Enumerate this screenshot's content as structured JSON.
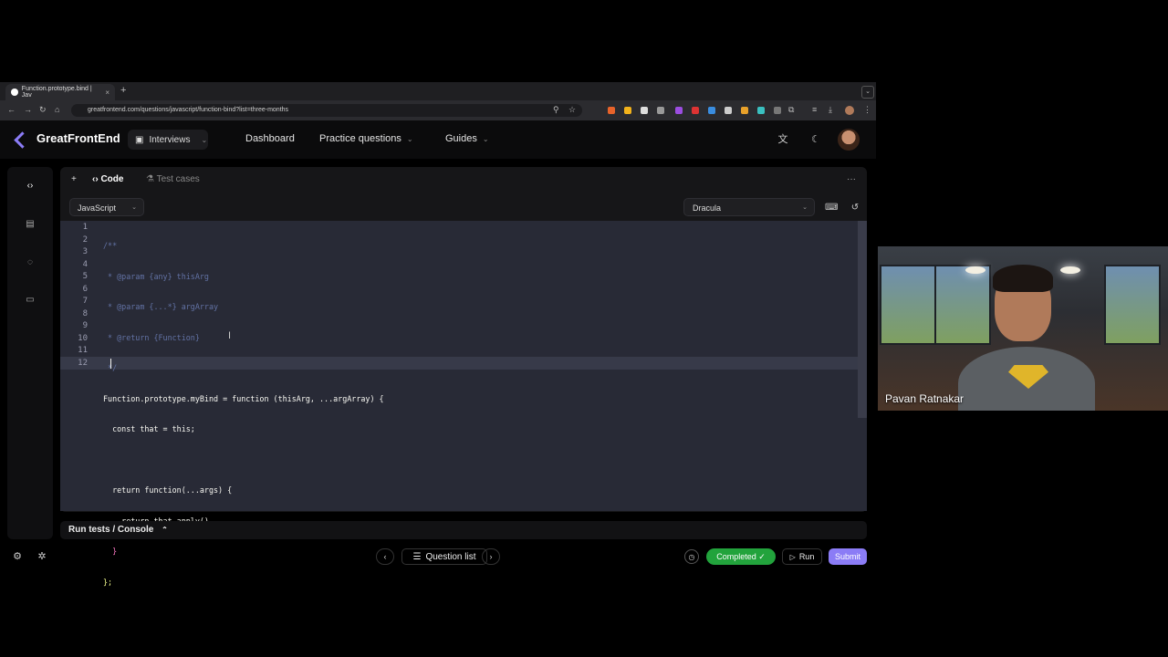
{
  "browser": {
    "tab_title": "Function.prototype.bind | Jav",
    "tab_close": "×",
    "new_tab": "+",
    "url": "greatfrontend.com/questions/javascript/function-bind?list=three-months"
  },
  "header": {
    "brand": "GreatFrontEnd",
    "interviews_label": "Interviews",
    "nav": [
      {
        "label": "Dashboard"
      },
      {
        "label": "Practice questions"
      },
      {
        "label": "Guides"
      }
    ]
  },
  "panel": {
    "add": "+",
    "code_tab": "Code",
    "test_tab": "Test cases",
    "more": "···",
    "language": "JavaScript",
    "theme": "Dracula"
  },
  "editor": {
    "line_numbers": [
      "1",
      "2",
      "3",
      "4",
      "5",
      "6",
      "7",
      "8",
      "9",
      "10",
      "11",
      "12"
    ],
    "lines": [
      "/**",
      " * @param {any} thisArg",
      " * @param {...*} argArray",
      " * @return {Function}",
      " */",
      "Function.prototype.myBind = function (thisArg, ...argArray) {",
      "  const that = this;",
      "",
      "  return function(...args) {",
      "    return that.apply()",
      "  }",
      "};"
    ]
  },
  "console": {
    "label": "Run tests / Console"
  },
  "footer": {
    "question_list": "Question list",
    "completed": "Completed ✓",
    "run": "Run",
    "submit": "Submit"
  },
  "webcam": {
    "name": "Pavan Ratnakar"
  },
  "colors": {
    "accent": "#8b7cf6",
    "completed": "#22a33c",
    "editor_bg": "#282a36"
  }
}
